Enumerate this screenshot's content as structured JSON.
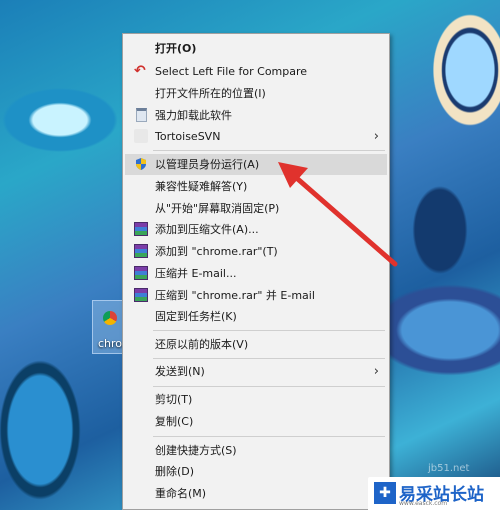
{
  "desktop": {
    "icon_label": "chrome"
  },
  "context_menu": {
    "items": [
      {
        "label": "打开(O)"
      },
      {
        "label": "Select Left File for Compare"
      },
      {
        "label": "打开文件所在的位置(I)"
      },
      {
        "label": "强力卸载此软件"
      },
      {
        "label": "TortoiseSVN"
      },
      {
        "label": "以管理员身份运行(A)"
      },
      {
        "label": "兼容性疑难解答(Y)"
      },
      {
        "label": "从\"开始\"屏幕取消固定(P)"
      },
      {
        "label": "添加到压缩文件(A)..."
      },
      {
        "label": "添加到 \"chrome.rar\"(T)"
      },
      {
        "label": "压缩并 E-mail..."
      },
      {
        "label": "压缩到 \"chrome.rar\" 并 E-mail"
      },
      {
        "label": "固定到任务栏(K)"
      },
      {
        "label": "还原以前的版本(V)"
      },
      {
        "label": "发送到(N)"
      },
      {
        "label": "剪切(T)"
      },
      {
        "label": "复制(C)"
      },
      {
        "label": "创建快捷方式(S)"
      },
      {
        "label": "删除(D)"
      },
      {
        "label": "重命名(M)"
      }
    ],
    "highlighted_index": 5,
    "submenu_arrow": "›"
  },
  "watermark": {
    "text": "易采站长站",
    "sub": "www.easck.com",
    "faint": "jb51.net"
  },
  "colors": {
    "menu_bg": "#f2f2f2",
    "highlight": "#d9d9d9",
    "arrow_red": "#e0322d"
  }
}
